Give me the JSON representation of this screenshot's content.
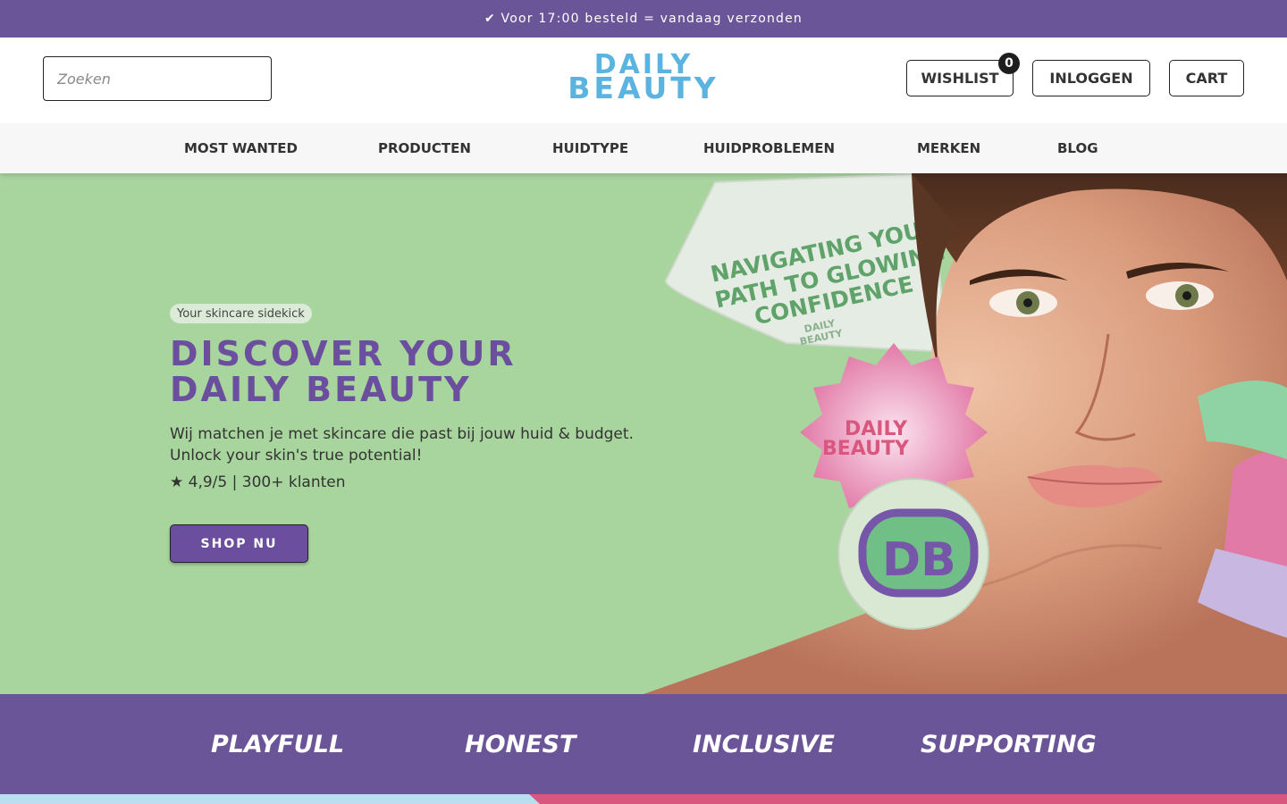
{
  "announcement": {
    "text": "✔ Voor 17:00 besteld = vandaag verzonden"
  },
  "header": {
    "search_placeholder": "Zoeken",
    "logo_line1": "DAILY",
    "logo_line2": "BEAUTY",
    "wishlist_label": "WISHLIST",
    "wishlist_count": "0",
    "login_label": "INLOGGEN",
    "cart_label": "CART"
  },
  "nav": {
    "items": [
      {
        "label": "MOST WANTED"
      },
      {
        "label": "PRODUCTEN"
      },
      {
        "label": "HUIDTYPE"
      },
      {
        "label": "HUIDPROBLEMEN"
      },
      {
        "label": "MERKEN"
      },
      {
        "label": "BLOG"
      }
    ]
  },
  "hero": {
    "tag": "Your skincare sidekick",
    "title_line1": "DISCOVER YOUR",
    "title_line2": "DAILY BEAUTY",
    "subtitle_line1": "Wij matchen je met skincare die past bij jouw huid & budget.",
    "subtitle_line2": "Unlock your skin's true potential!",
    "rating": "★ 4,9/5 | 300+ klanten",
    "cta_label": "SHOP NU",
    "sticker1": [
      "NAVIGATING YOUR",
      "PATH TO GLOWING",
      "CONFIDENCE"
    ],
    "sticker1_small": [
      "DAILY",
      "BEAUTY"
    ],
    "sticker2": [
      "DAILY",
      "BEAUTY"
    ],
    "sticker3": "DB"
  },
  "values": {
    "items": [
      {
        "label": "PLAYFULL"
      },
      {
        "label": "HONEST"
      },
      {
        "label": "INCLUSIVE"
      },
      {
        "label": "SUPPORTING"
      }
    ]
  },
  "colors": {
    "brand_purple": "#6b5599",
    "logo_blue": "#5bb3e0",
    "hero_green": "#a8d49e",
    "sticker_pink": "#e27aa8",
    "strip_blue": "#b9def0",
    "strip_pink": "#d9577f"
  }
}
